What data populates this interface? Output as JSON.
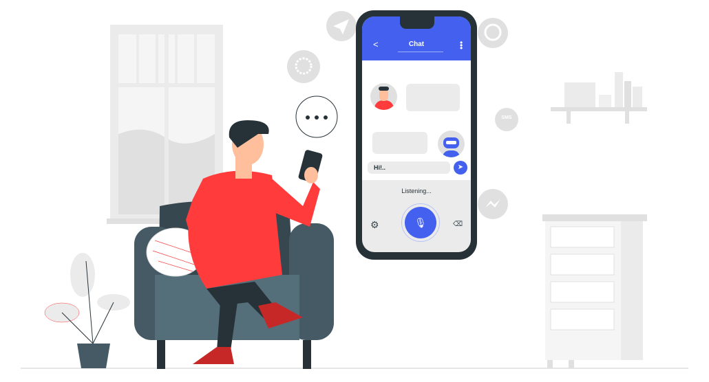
{
  "phone": {
    "header": {
      "back_icon": "chevron-left-icon",
      "title": "Chat",
      "menu_icon": "kebab-menu-icon"
    },
    "input_value": "Hi!..",
    "send_icon": "send-icon",
    "status": "Listening...",
    "settings_icon": "gear-icon",
    "mic_icon": "microphone-icon",
    "backspace_icon": "backspace-icon"
  },
  "floating_icons": {
    "sms": "SMS",
    "icons": [
      "telegram-icon",
      "whatsapp-icon",
      "signal-icon",
      "sms-icon",
      "messenger-icon",
      "typing-bubble-icon"
    ]
  },
  "colors": {
    "accent": "#4360ee",
    "shirt": "#ff3b3b",
    "dark": "#263238",
    "sofa": "#455a64"
  }
}
